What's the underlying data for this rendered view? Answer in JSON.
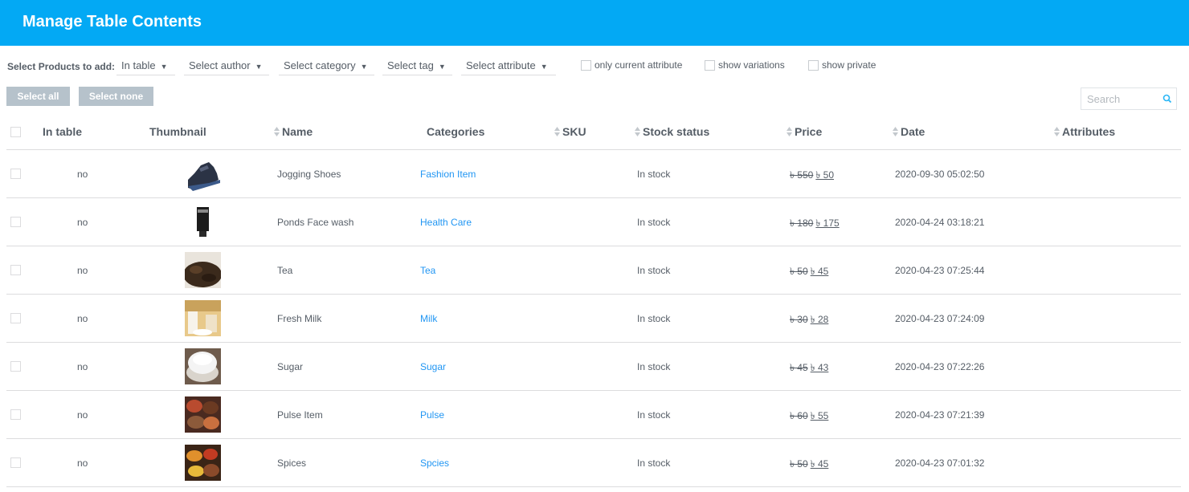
{
  "header": {
    "title": "Manage Table Contents"
  },
  "filters": {
    "label": "Select Products to add:",
    "in_table": "In table",
    "author": "Select author",
    "category": "Select category",
    "tag": "Select tag",
    "attribute": "Select attribute",
    "arrow": "▼",
    "only_current_attribute": "only current attribute",
    "show_variations": "show variations",
    "show_private": "show private"
  },
  "buttons": {
    "select_all": "Select all",
    "select_none": "Select none"
  },
  "search": {
    "placeholder": "Search"
  },
  "columns": {
    "in_table": "In table",
    "thumbnail": "Thumbnail",
    "name": "Name",
    "categories": "Categories",
    "sku": "SKU",
    "stock_status": "Stock status",
    "price": "Price",
    "date": "Date",
    "attributes": "Attributes"
  },
  "rows": [
    {
      "in_table": "no",
      "thumb": "shoe-thumbnail",
      "name": "Jogging Shoes",
      "category": "Fashion Item",
      "stock": "In stock",
      "price_old": "৳ 550",
      "price_new": "৳ 50",
      "date": "2020-09-30 05:02:50"
    },
    {
      "in_table": "no",
      "thumb": "facewash-thumbnail",
      "name": "Ponds Face wash",
      "category": "Health Care",
      "stock": "In stock",
      "price_old": "৳ 180",
      "price_new": "৳ 175",
      "date": "2020-04-24 03:18:21"
    },
    {
      "in_table": "no",
      "thumb": "tea-thumbnail",
      "name": "Tea",
      "category": "Tea",
      "stock": "In stock",
      "price_old": "৳ 50",
      "price_new": "৳ 45",
      "date": "2020-04-23 07:25:44"
    },
    {
      "in_table": "no",
      "thumb": "milk-thumbnail",
      "name": "Fresh Milk",
      "category": "Milk",
      "stock": "In stock",
      "price_old": "৳ 30",
      "price_new": "৳ 28",
      "date": "2020-04-23 07:24:09"
    },
    {
      "in_table": "no",
      "thumb": "sugar-thumbnail",
      "name": "Sugar",
      "category": "Sugar",
      "stock": "In stock",
      "price_old": "৳ 45",
      "price_new": "৳ 43",
      "date": "2020-04-23 07:22:26"
    },
    {
      "in_table": "no",
      "thumb": "pulse-thumbnail",
      "name": "Pulse Item",
      "category": "Pulse",
      "stock": "In stock",
      "price_old": "৳ 60",
      "price_new": "৳ 55",
      "date": "2020-04-23 07:21:39"
    },
    {
      "in_table": "no",
      "thumb": "spices-thumbnail",
      "name": "Spices",
      "category": "Spcies",
      "stock": "In stock",
      "price_old": "৳ 50",
      "price_new": "৳ 45",
      "date": "2020-04-23 07:01:32"
    }
  ],
  "colors": {
    "header": "#03a9f4",
    "link": "#2196f3",
    "button": "#b6c2cb",
    "text": "#555d66"
  }
}
